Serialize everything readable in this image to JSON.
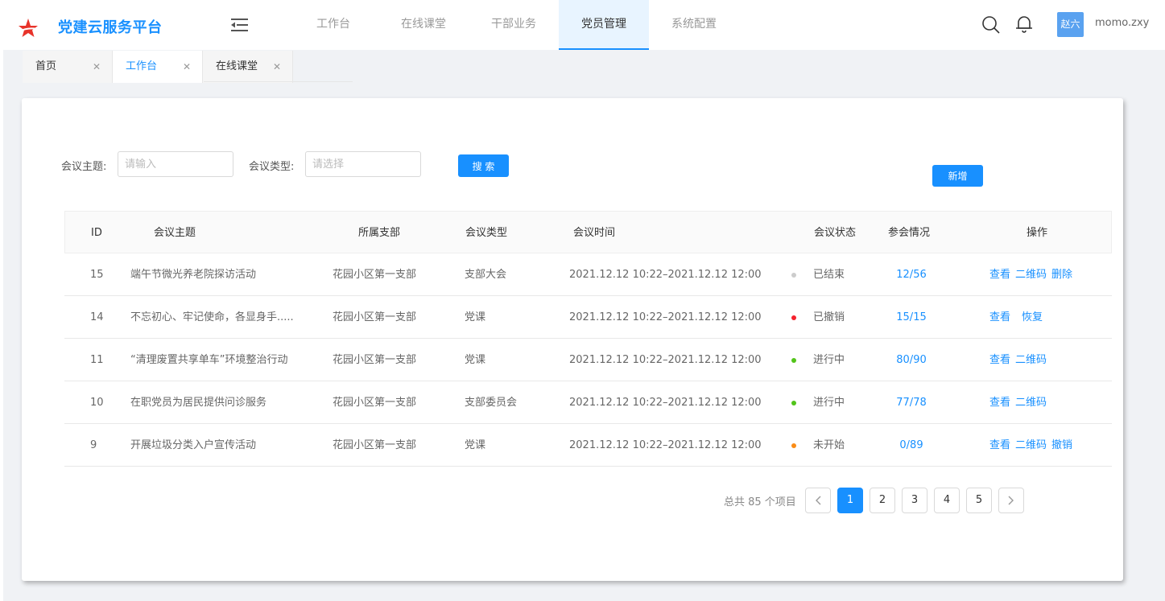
{
  "app": {
    "title": "党建云服务平台"
  },
  "nav": {
    "items": [
      "工作台",
      "在线课堂",
      "干部业务",
      "党员管理",
      "系统配置"
    ],
    "active_index": 3
  },
  "user": {
    "avatar_text": "赵六",
    "username": "momo.zxy"
  },
  "tabs": [
    {
      "label": "首页"
    },
    {
      "label": "工作台"
    },
    {
      "label": "在线课堂"
    }
  ],
  "active_tab_index": 1,
  "filters": {
    "topic_label": "会议主题:",
    "topic_placeholder": "请输入",
    "type_label": "会议类型:",
    "type_placeholder": "请选择",
    "search_label": "搜 索",
    "add_label": "新增"
  },
  "table": {
    "headers": [
      "ID",
      "会议主题",
      "所属支部",
      "会议类型",
      "会议时间",
      "会议状态",
      "参会情况",
      "操作"
    ],
    "rows": [
      {
        "id": "15",
        "topic": "端午节微光养老院探访活动",
        "branch": "花园小区第一支部",
        "type": "支部大会",
        "time": "2021.12.12 10:22–2021.12.12 12:00",
        "status": "已结束",
        "attendance": "12/56",
        "actions": [
          "查看",
          "二维码",
          "删除"
        ]
      },
      {
        "id": "14",
        "topic": "不忘初心、牢记使命，各显身手.....",
        "branch": "花园小区第一支部",
        "type": "党课",
        "time": "2021.12.12 10:22–2021.12.12 12:00",
        "status": "已撤销",
        "attendance": "15/15",
        "actions": [
          "查看",
          "恢复"
        ]
      },
      {
        "id": "11",
        "topic": "“清理废置共享单车”环境整治行动",
        "branch": "花园小区第一支部",
        "type": "党课",
        "time": "2021.12.12 10:22–2021.12.12 12:00",
        "status": "进行中",
        "attendance": "80/90",
        "actions": [
          "查看",
          "二维码"
        ]
      },
      {
        "id": "10",
        "topic": "在职党员为居民提供问诊服务",
        "branch": "花园小区第一支部",
        "type": "支部委员会",
        "time": "2021.12.12 10:22–2021.12.12 12:00",
        "status": "进行中",
        "attendance": "77/78",
        "actions": [
          "查看",
          "二维码"
        ]
      },
      {
        "id": "9",
        "topic": "开展垃圾分类入户宣传活动",
        "branch": "花园小区第一支部",
        "type": "党课",
        "time": "2021.12.12 10:22–2021.12.12 12:00",
        "status": "未开始",
        "attendance": "0/89",
        "actions": [
          "查看",
          "二维码",
          "撤销"
        ]
      }
    ]
  },
  "status_colors": {
    "已结束": "#cccccc",
    "已撤销": "#f5222d",
    "进行中": "#52c41a",
    "未开始": "#fa8c16"
  },
  "pagination": {
    "total_text": "总共 85 个项目",
    "pages": [
      "1",
      "2",
      "3",
      "4",
      "5"
    ],
    "current": "1"
  }
}
